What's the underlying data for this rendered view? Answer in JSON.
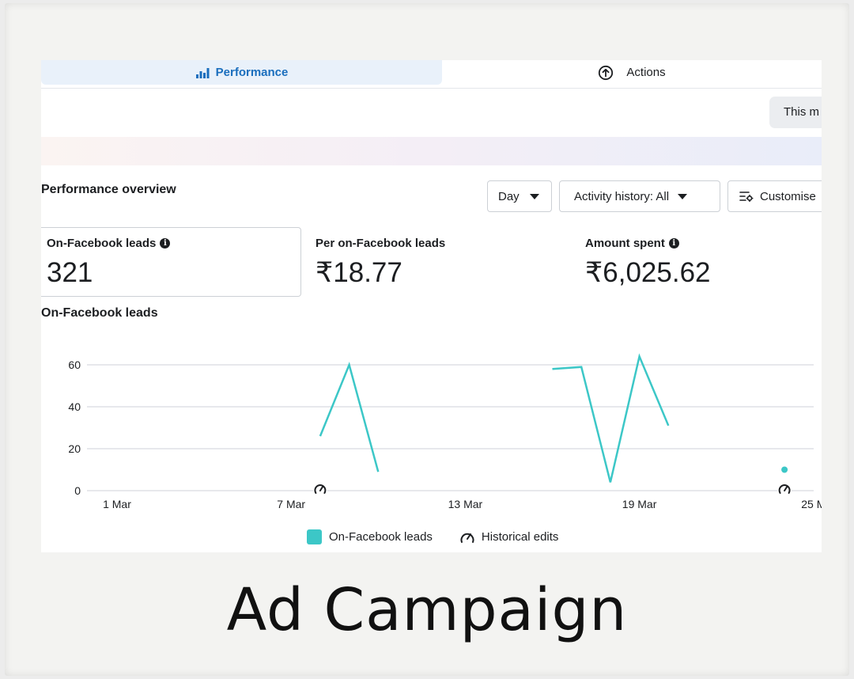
{
  "tabs": {
    "performance": {
      "label": "Performance",
      "icon": "bar-chart-icon"
    },
    "actions": {
      "label": "Actions",
      "icon": "arrow-up-circle-icon"
    }
  },
  "banner": {
    "button_text": "This m"
  },
  "overview": {
    "title": "Performance overview",
    "day_select": "Day",
    "activity_select": "Activity history: All",
    "customise_button": "Customise"
  },
  "metrics": [
    {
      "label": "On-Facebook leads",
      "value": "321",
      "info": true
    },
    {
      "label": "Per on-Facebook leads",
      "value": "₹18.77",
      "info": false
    },
    {
      "label": "Amount spent",
      "value": "₹6,025.62",
      "info": true
    }
  ],
  "chart_title": "On-Facebook leads",
  "chart_data": {
    "type": "line",
    "title": "On-Facebook leads",
    "xlabel": "",
    "ylabel": "",
    "ylim": [
      0,
      60
    ],
    "yticks": [
      0,
      20,
      40,
      60
    ],
    "xticks": [
      "1 Mar",
      "7 Mar",
      "13 Mar",
      "19 Mar",
      "25 M"
    ],
    "grid": true,
    "legend_position": "bottom",
    "series": [
      {
        "name": "On-Facebook leads",
        "color": "#3cc7c7",
        "segments": [
          [
            {
              "x": "8 Mar",
              "y": 26
            },
            {
              "x": "9 Mar",
              "y": 60
            },
            {
              "x": "10 Mar",
              "y": 9
            }
          ],
          [
            {
              "x": "16 Mar",
              "y": 58
            },
            {
              "x": "17 Mar",
              "y": 59
            },
            {
              "x": "18 Mar",
              "y": 4
            },
            {
              "x": "19 Mar",
              "y": 64
            },
            {
              "x": "20 Mar",
              "y": 31
            }
          ],
          [
            {
              "x": "24 Mar",
              "y": 10
            }
          ]
        ]
      }
    ],
    "historical_edits": [
      "8 Mar",
      "24 Mar"
    ]
  },
  "legend": {
    "series_label": "On-Facebook leads",
    "edits_label": "Historical edits",
    "edits_icon": "gauge-icon"
  },
  "caption": "Ad Campaign"
}
